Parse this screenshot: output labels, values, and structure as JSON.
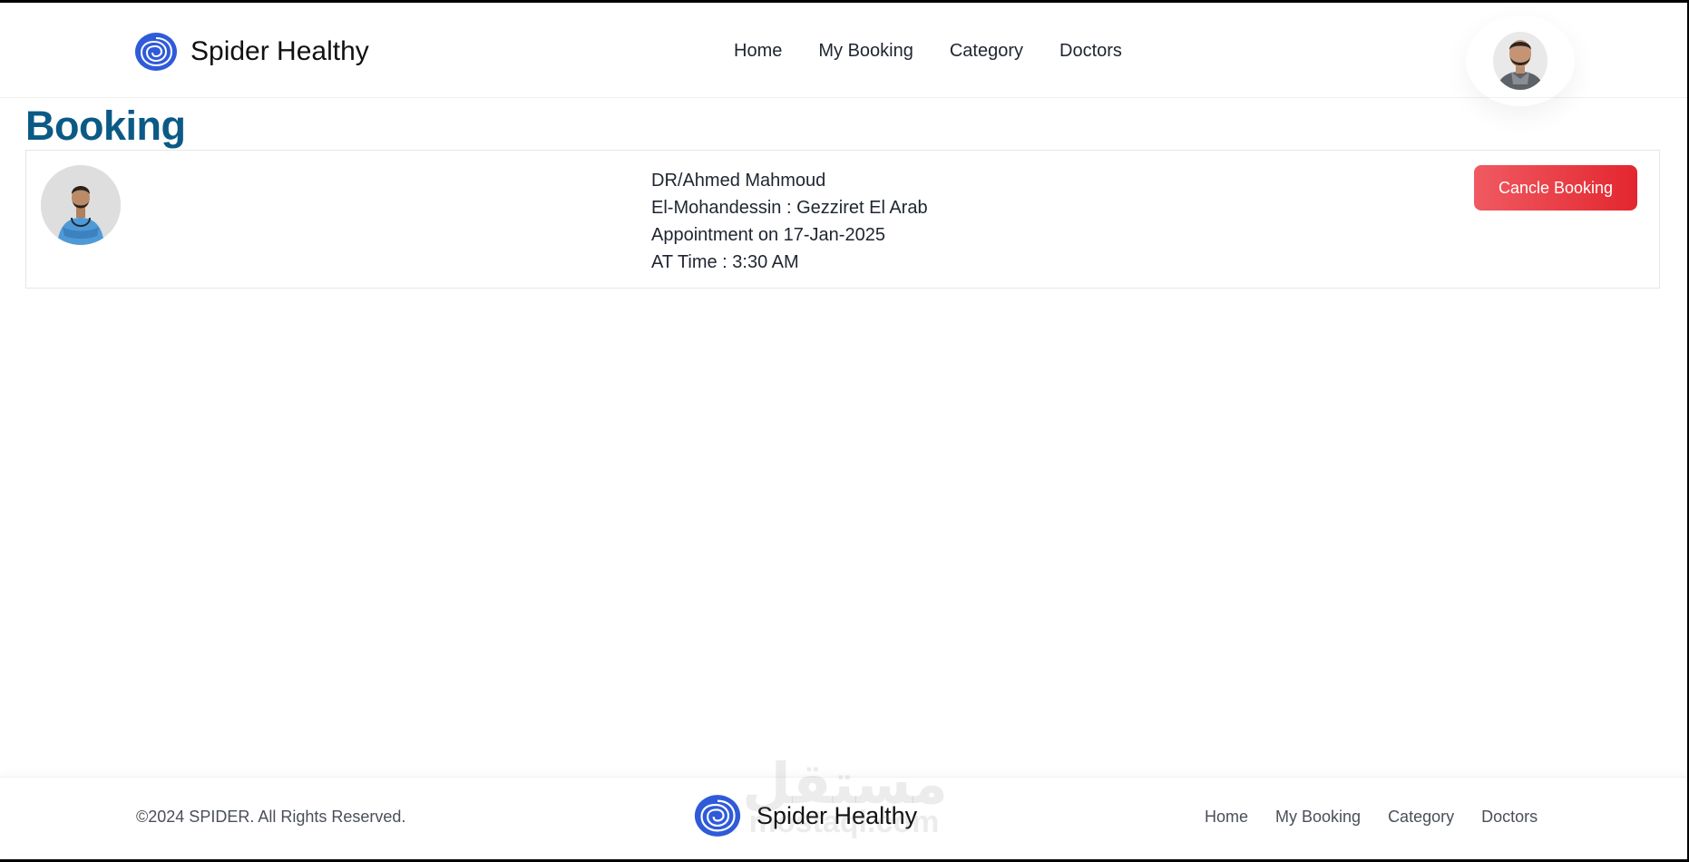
{
  "brand": {
    "name": "Spider Healthy",
    "logo_icon": "spiral-logo-icon",
    "accent": "#2f5bd9"
  },
  "nav": {
    "items": [
      {
        "label": "Home"
      },
      {
        "label": "My Booking"
      },
      {
        "label": "Category"
      },
      {
        "label": "Doctors"
      }
    ]
  },
  "user": {
    "avatar_icon": "user-avatar"
  },
  "page": {
    "title": "Booking",
    "title_color": "#0b5a86"
  },
  "booking": {
    "doctor": "DR/Ahmed Mahmoud",
    "location": "El-Mohandessin : Gezziret El Arab",
    "appointment": "Appointment on 17-Jan-2025",
    "time": "AT Time : 3:30 AM",
    "cancel_label": "Cancle Booking",
    "cancel_color": "#e3262f"
  },
  "footer": {
    "copyright": "©2024 SPIDER. All Rights Reserved.",
    "brand_name": "Spider Healthy",
    "watermark_ar": "مستقل",
    "watermark_en": "mostaql.com",
    "nav": [
      {
        "label": "Home"
      },
      {
        "label": "My Booking"
      },
      {
        "label": "Category"
      },
      {
        "label": "Doctors"
      }
    ]
  }
}
